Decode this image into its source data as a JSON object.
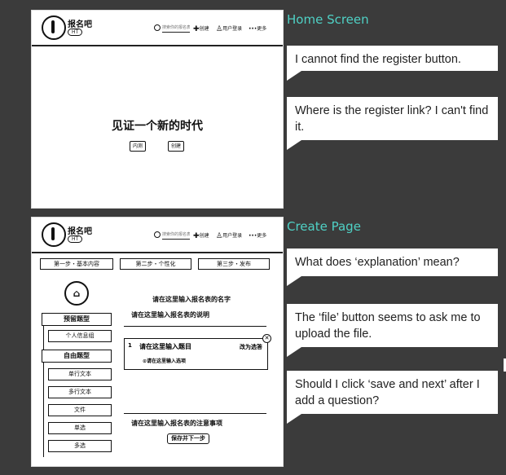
{
  "header": {
    "brand": "报名吧",
    "tag": "HT",
    "search_placeholder": "搜索你的报名表",
    "nav": [
      "创建",
      "用户登录",
      "更多"
    ]
  },
  "home": {
    "hero": "见证一个新的时代",
    "buttons": [
      "内测",
      "创建"
    ]
  },
  "create": {
    "steps": [
      "第一步・基本内容",
      "第二步・个性化",
      "第三步・发布"
    ],
    "sidebar": [
      "预留题型",
      "个人信息组",
      "自由题型",
      "单行文本",
      "多行文本",
      "文件",
      "单选",
      "多选"
    ],
    "form_title": "请在这里输入报名表的名字",
    "form_desc": "请在这里输入报名表的说明",
    "question": {
      "number": "1",
      "title": "请在这里输入题目",
      "change": "改为选答",
      "option": "请在这里输入选项"
    },
    "notes": "请在这里输入报名表的注意事项",
    "save": "保存并下一步"
  },
  "annotations": {
    "home_title": "Home Screen",
    "create_title": "Create Page",
    "home_comments": [
      "I cannot find the register button.",
      "Where is the register link? I can't find it."
    ],
    "create_comments": [
      "What does ‘explanation’ mean?",
      "The ‘file’ button seems to ask me to upload the file.",
      "Should I click ‘save and next’ after I add a question?"
    ]
  },
  "colors": {
    "background": "#3b3b3b",
    "accent": "#4fd1c5"
  }
}
